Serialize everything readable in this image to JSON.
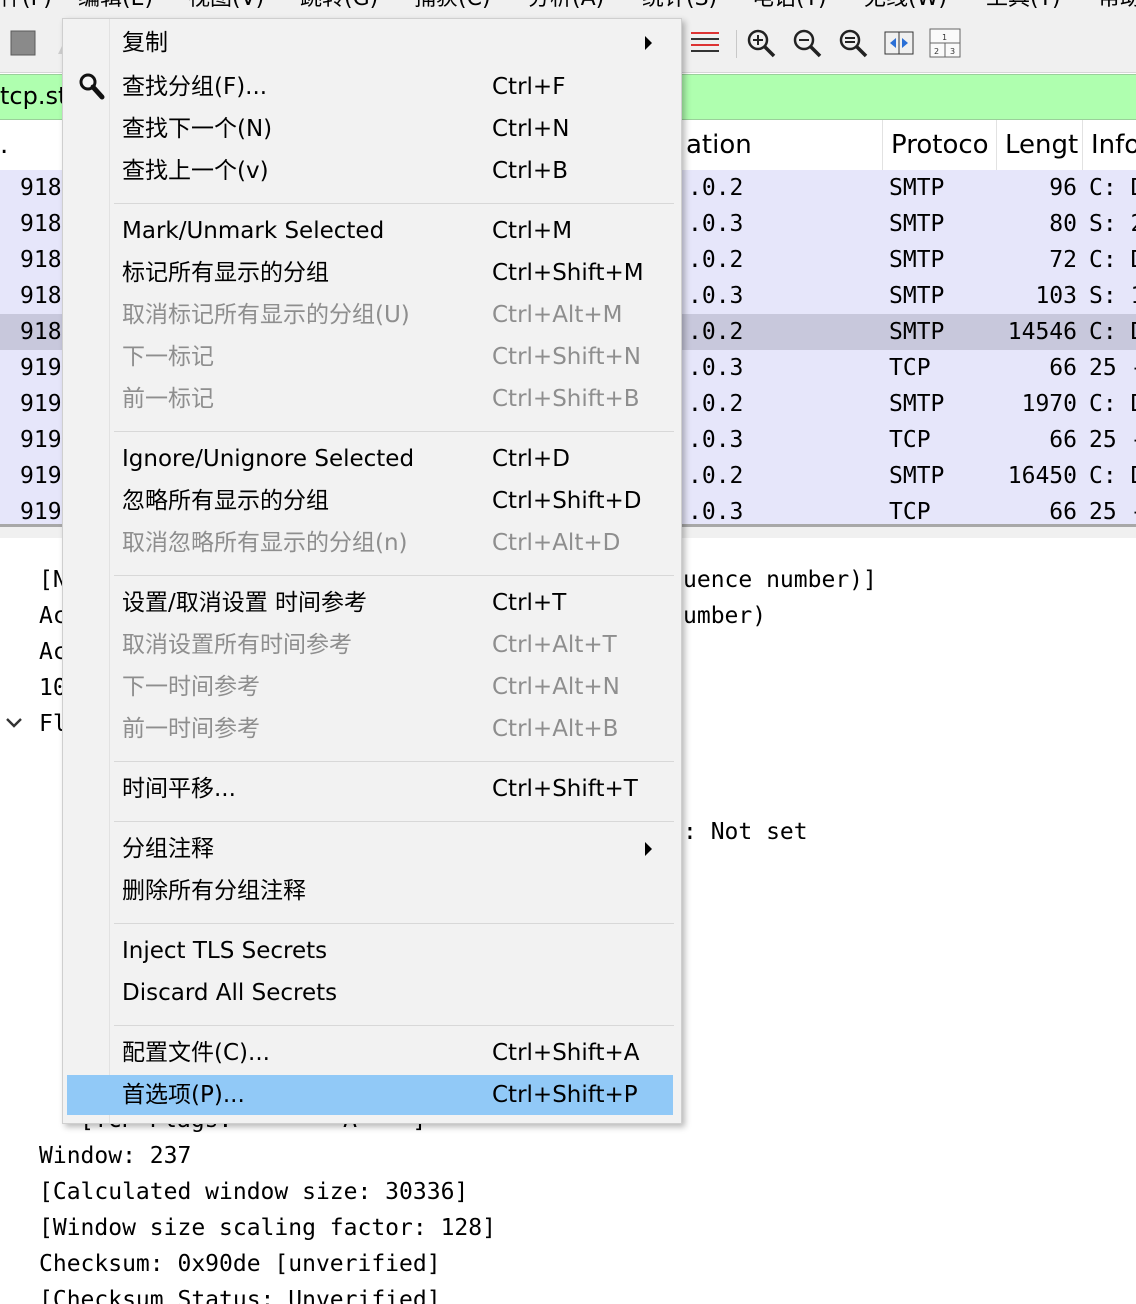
{
  "menubar": {
    "items": [
      "件(F)",
      "编辑(E)",
      "视图(V)",
      "跳转(G)",
      "捕获(C)",
      "分析(A)",
      "统计(S)",
      "电话(Y)",
      "无线(W)",
      "工具(T)",
      "帮助"
    ]
  },
  "filter": {
    "value": "tcp.st"
  },
  "packet_list": {
    "headers": {
      "no": ".",
      "destination": "ation",
      "protocol": "Protoco",
      "length": "Lengt",
      "info": "Info"
    },
    "rows": [
      {
        "no": "918",
        "dest": ".0.2",
        "proto": "SMTP",
        "len": "96",
        "info": "C: D"
      },
      {
        "no": "918",
        "dest": ".0.3",
        "proto": "SMTP",
        "len": "80",
        "info": "S: 2"
      },
      {
        "no": "918",
        "dest": ".0.2",
        "proto": "SMTP",
        "len": "72",
        "info": "C: D"
      },
      {
        "no": "918",
        "dest": ".0.3",
        "proto": "SMTP",
        "len": "103",
        "info": "S: 1"
      },
      {
        "no": "918",
        "dest": ".0.2",
        "proto": "SMTP",
        "len": "14546",
        "info": "C: D"
      },
      {
        "no": "919",
        "dest": ".0.3",
        "proto": "TCP",
        "len": "66",
        "info": "25 -"
      },
      {
        "no": "919",
        "dest": ".0.2",
        "proto": "SMTP",
        "len": "1970",
        "info": "C: D"
      },
      {
        "no": "919",
        "dest": ".0.3",
        "proto": "TCP",
        "len": "66",
        "info": "25 -"
      },
      {
        "no": "919",
        "dest": ".0.2",
        "proto": "SMTP",
        "len": "16450",
        "info": "C: D"
      },
      {
        "no": "919",
        "dest": ".0.3",
        "proto": "TCP",
        "len": "66",
        "info": "25 -"
      }
    ],
    "selected_row": 4
  },
  "details": {
    "left_fragments": [
      "[N",
      "Ac",
      "Ac",
      "10",
      "Fl"
    ],
    "right_fragments": [
      "uence number)]",
      "umber)",
      ": Not set"
    ],
    "lines": [
      "[TCP Flags: ·······A····]",
      "Window: 237",
      "[Calculated window size: 30336]",
      "[Window size scaling factor: 128]",
      "Checksum: 0x90de [unverified]",
      "[Checksum Status: Unverified]"
    ]
  },
  "edit_menu": {
    "items": [
      {
        "label": "复制",
        "shortcut": "",
        "submenu": true,
        "disabled": false
      },
      {
        "label": "查找分组(F)...",
        "shortcut": "Ctrl+F",
        "icon": "search-icon",
        "disabled": false
      },
      {
        "label": "查找下一个(N)",
        "shortcut": "Ctrl+N",
        "disabled": false
      },
      {
        "label": "查找上一个(v)",
        "shortcut": "Ctrl+B",
        "disabled": false
      },
      {
        "label": "Mark/Unmark Selected",
        "shortcut": "Ctrl+M",
        "disabled": false
      },
      {
        "label": "标记所有显示的分组",
        "shortcut": "Ctrl+Shift+M",
        "disabled": false
      },
      {
        "label": "取消标记所有显示的分组(U)",
        "shortcut": "Ctrl+Alt+M",
        "disabled": true
      },
      {
        "label": "下一标记",
        "shortcut": "Ctrl+Shift+N",
        "disabled": true
      },
      {
        "label": "前一标记",
        "shortcut": "Ctrl+Shift+B",
        "disabled": true
      },
      {
        "label": "Ignore/Unignore Selected",
        "shortcut": "Ctrl+D",
        "disabled": false
      },
      {
        "label": "忽略所有显示的分组",
        "shortcut": "Ctrl+Shift+D",
        "disabled": false
      },
      {
        "label": "取消忽略所有显示的分组(n)",
        "shortcut": "Ctrl+Alt+D",
        "disabled": true
      },
      {
        "label": "设置/取消设置 时间参考",
        "shortcut": "Ctrl+T",
        "disabled": false
      },
      {
        "label": "取消设置所有时间参考",
        "shortcut": "Ctrl+Alt+T",
        "disabled": true
      },
      {
        "label": "下一时间参考",
        "shortcut": "Ctrl+Alt+N",
        "disabled": true
      },
      {
        "label": "前一时间参考",
        "shortcut": "Ctrl+Alt+B",
        "disabled": true
      },
      {
        "label": "时间平移...",
        "shortcut": "Ctrl+Shift+T",
        "disabled": false
      },
      {
        "label": "分组注释",
        "shortcut": "",
        "submenu": true,
        "disabled": false
      },
      {
        "label": "删除所有分组注释",
        "shortcut": "",
        "disabled": false
      },
      {
        "label": "Inject TLS Secrets",
        "shortcut": "",
        "disabled": false
      },
      {
        "label": "Discard All Secrets",
        "shortcut": "",
        "disabled": false
      },
      {
        "label": "配置文件(C)...",
        "shortcut": "Ctrl+Shift+A",
        "disabled": false
      },
      {
        "label": "首选项(P)...",
        "shortcut": "Ctrl+Shift+P",
        "disabled": false,
        "highlighted": true
      }
    ]
  },
  "colors": {
    "filter_ok": "#afffaf",
    "row_bg": "#e6e6fa",
    "row_selected": "#c8c8dc",
    "menu_highlight": "#91c9f7",
    "disabled_text": "#8e8e8e"
  }
}
